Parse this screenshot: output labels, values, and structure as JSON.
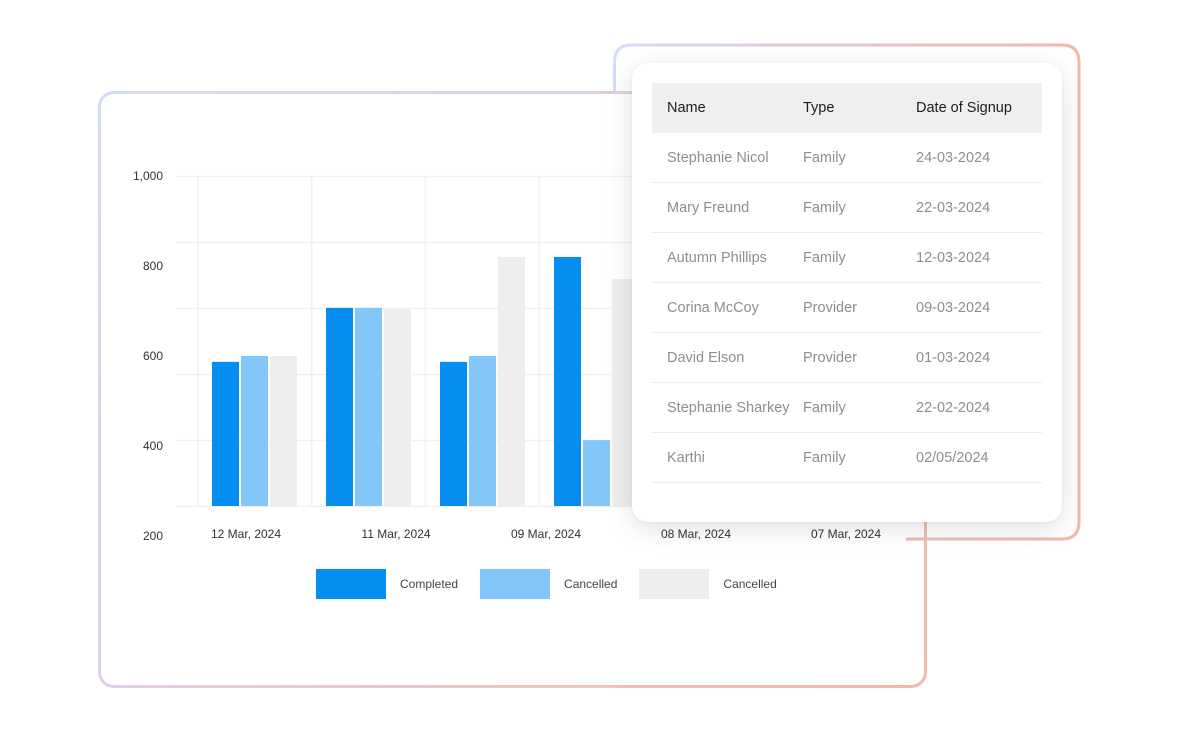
{
  "chart_data": {
    "type": "bar",
    "title": "",
    "xlabel": "",
    "ylabel": "",
    "categories": [
      "12 Mar, 2024",
      "11 Mar, 2024",
      "09 Mar, 2024",
      "08 Mar, 2024",
      "07 Mar, 2024"
    ],
    "y_ticks": [
      "1,000",
      "800",
      "600",
      "400",
      "200"
    ],
    "ylim": [
      200,
      1000
    ],
    "grid": true,
    "legend_position": "bottom",
    "series": [
      {
        "name": "Completed",
        "color": "#068df0",
        "values": [
          587,
          707,
          587,
          820,
          null
        ]
      },
      {
        "name": "Cancelled",
        "color": "#82c6fa",
        "values": [
          600,
          707,
          600,
          413,
          null
        ]
      },
      {
        "name": "Cancelled",
        "color": "#eeeeee",
        "values": [
          600,
          707,
          820,
          771,
          null
        ]
      }
    ]
  },
  "legend": [
    {
      "label": "Completed",
      "color": "#068df0"
    },
    {
      "label": "Cancelled",
      "color": "#82c6fa"
    },
    {
      "label": "Cancelled",
      "color": "#eeeeee"
    }
  ],
  "table": {
    "headers": [
      "Name",
      "Type",
      "Date of Signup"
    ],
    "rows": [
      [
        "Stephanie Nicol",
        "Family",
        "24-03-2024"
      ],
      [
        "Mary Freund",
        "Family",
        "22-03-2024"
      ],
      [
        "Autumn Phillips",
        "Family",
        "12-03-2024"
      ],
      [
        "Corina McCoy",
        "Provider",
        "09-03-2024"
      ],
      [
        "David Elson",
        "Provider",
        "01-03-2024"
      ],
      [
        "Stephanie Sharkey",
        "Family",
        "22-02-2024"
      ],
      [
        "Karthi",
        "Family",
        "02/05/2024"
      ]
    ]
  }
}
